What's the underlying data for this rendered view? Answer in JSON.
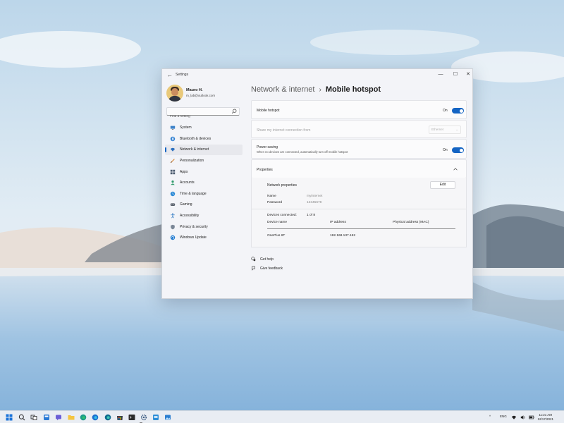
{
  "window": {
    "app_title": "Settings",
    "back_glyph": "←",
    "min_glyph": "—",
    "max_glyph": "☐",
    "close_glyph": "✕"
  },
  "profile": {
    "name": "Mauro H.",
    "email": "m_lab@outlook.com"
  },
  "search": {
    "placeholder": "Find a setting"
  },
  "sidebar": {
    "items": [
      {
        "label": "System",
        "icon": "monitor-icon",
        "active": false
      },
      {
        "label": "Bluetooth & devices",
        "icon": "bluetooth-icon",
        "active": false
      },
      {
        "label": "Network & internet",
        "icon": "wifi-icon",
        "active": true
      },
      {
        "label": "Personalization",
        "icon": "brush-icon",
        "active": false
      },
      {
        "label": "Apps",
        "icon": "apps-icon",
        "active": false
      },
      {
        "label": "Accounts",
        "icon": "person-icon",
        "active": false
      },
      {
        "label": "Time & language",
        "icon": "globe-clock-icon",
        "active": false
      },
      {
        "label": "Gaming",
        "icon": "gamepad-icon",
        "active": false
      },
      {
        "label": "Accessibility",
        "icon": "accessibility-icon",
        "active": false
      },
      {
        "label": "Privacy & security",
        "icon": "shield-icon",
        "active": false
      },
      {
        "label": "Windows Update",
        "icon": "update-icon",
        "active": false
      }
    ]
  },
  "breadcrumb": {
    "parent": "Network & internet",
    "separator": "›",
    "current": "Mobile hotspot"
  },
  "hotspot": {
    "label": "Mobile hotspot",
    "toggle_text": "On",
    "toggle_on": true
  },
  "share": {
    "label": "Share my internet connection from",
    "value": "Ethernet",
    "caret": "⌄"
  },
  "power_saving": {
    "label": "Power saving",
    "description": "When no devices are connected, automatically turn off mobile hotspot",
    "toggle_text": "On",
    "toggle_on": true
  },
  "properties": {
    "label": "Properties",
    "expanded": true,
    "network_properties_label": "Network properties",
    "edit_label": "Edit",
    "name_key": "Name",
    "name_value": "myinternet",
    "password_key": "Password",
    "password_value": "12345678",
    "devices_connected_label": "Devices connected:",
    "devices_connected_value": "1 of 8",
    "columns": [
      "Device name",
      "IP address",
      "Physical address (MAC)"
    ],
    "rows": [
      {
        "device": "OnePlus 6T",
        "ip": "192.168.137.152",
        "mac": ""
      }
    ]
  },
  "links": {
    "get_help": "Get help",
    "give_feedback": "Give feedback"
  },
  "taskbar": {
    "apps": [
      "windows-start-icon",
      "search-icon",
      "task-view-icon",
      "widgets-icon",
      "chat-icon",
      "file-explorer-icon",
      "edge-icon",
      "edge-beta-icon",
      "edge-dev-icon",
      "store-icon",
      "terminal-icon",
      "settings-icon",
      "app-icon",
      "photos-icon"
    ],
    "lang": "ENG",
    "time": "11:21 AM",
    "date": "12/17/2021"
  },
  "colors": {
    "accent": "#1464c3",
    "window_bg": "#f3f4f8",
    "card_bg": "#fbfbfc",
    "taskbar_bg": "#e9edf3"
  }
}
